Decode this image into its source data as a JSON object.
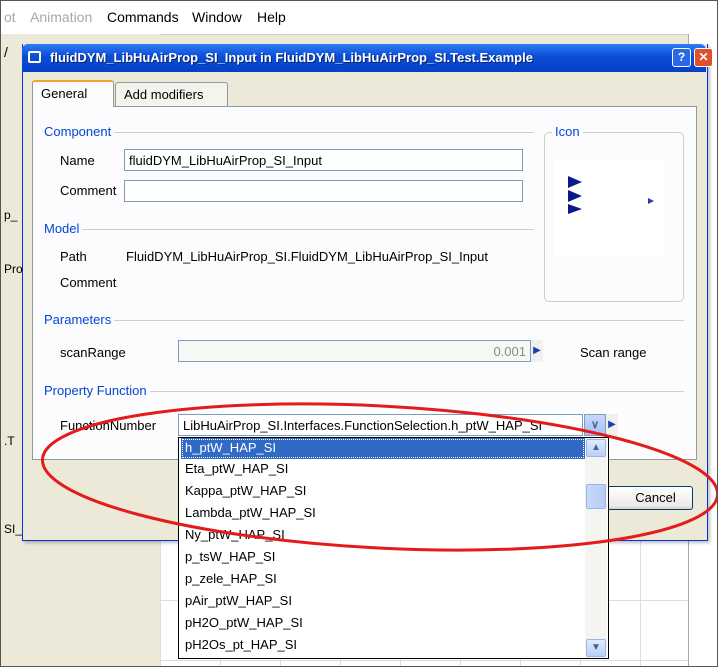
{
  "app": {
    "menu": [
      {
        "label": "ot",
        "disabled": true
      },
      {
        "label": "Animation",
        "disabled": true
      },
      {
        "label": "Commands",
        "disabled": false
      },
      {
        "label": "Window",
        "disabled": false
      },
      {
        "label": "Help",
        "disabled": false
      }
    ],
    "left_fragments": [
      "/",
      "p_",
      "Pro",
      ".T",
      "SI_Input"
    ]
  },
  "dialog": {
    "title": "fluidDYM_LibHuAirProp_SI_Input in FluidDYM_LibHuAirProp_SI.Test.Example",
    "help_glyph": "?",
    "close_glyph": "✕",
    "tabs": [
      "General",
      "Add modifiers"
    ],
    "component": {
      "group_label": "Component",
      "name_label": "Name",
      "name_value": "fluidDYM_LibHuAirProp_SI_Input",
      "comment_label": "Comment",
      "comment_value": ""
    },
    "icon_group_label": "Icon",
    "model": {
      "group_label": "Model",
      "path_label": "Path",
      "path_value": "FluidDYM_LibHuAirProp_SI.FluidDYM_LibHuAirProp_SI_Input",
      "comment_label": "Comment"
    },
    "parameters": {
      "group_label": "Parameters",
      "param_name": "scanRange",
      "param_value": "0.001",
      "param_desc": "Scan range"
    },
    "property_function": {
      "group_label": "Property Function",
      "label": "FunctionNumber",
      "value": "LibHuAirProp_SI.Interfaces.FunctionSelection.h_ptW_HAP_SI",
      "options": [
        "h_ptW_HAP_SI",
        "Eta_ptW_HAP_SI",
        "Kappa_ptW_HAP_SI",
        "Lambda_ptW_HAP_SI",
        "Ny_ptW_HAP_SI",
        "p_tsW_HAP_SI",
        "p_zele_HAP_SI",
        "pAir_ptW_HAP_SI",
        "pH2O_ptW_HAP_SI",
        "pH2Os_pt_HAP_SI"
      ],
      "selected_index": 0
    },
    "cancel_label": "Cancel"
  },
  "highlight_color": "#e41b1b"
}
